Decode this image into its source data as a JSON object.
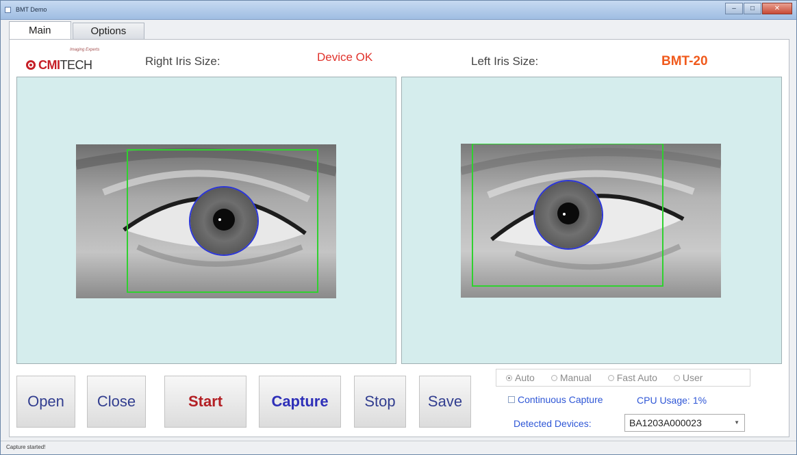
{
  "window": {
    "title": "BMT Demo",
    "controls": [
      "–",
      "□",
      "✕"
    ]
  },
  "tabs": [
    {
      "label": "Main",
      "active": true
    },
    {
      "label": "Options",
      "active": false
    }
  ],
  "logo": {
    "tagline": "Imaging Experts",
    "brand_bold": "CMI",
    "brand_rest": "TECH"
  },
  "header": {
    "right_iris_label": "Right Iris Size:",
    "device_status": "Device OK",
    "left_iris_label": "Left Iris Size:",
    "device_model": "BMT-20"
  },
  "buttons": {
    "open": "Open",
    "close": "Close",
    "start": "Start",
    "capture": "Capture",
    "stop": "Stop",
    "save": "Save"
  },
  "capture_modes": {
    "options": [
      "Auto",
      "Manual",
      "Fast Auto",
      "User"
    ],
    "selected": "Auto"
  },
  "continuous_capture": {
    "label": "Continuous Capture",
    "checked": false
  },
  "cpu_usage": {
    "label": "CPU Usage:",
    "value": "1%"
  },
  "detected_devices": {
    "label": "Detected Devices:",
    "selected": "BA1203A000023"
  },
  "status_bar": {
    "text": "Capture started!"
  },
  "colors": {
    "view_background": "#d5eded",
    "roi_box": "#2fd12f",
    "iris_circle": "#2b35d6",
    "status_ok": "#e0322b",
    "model": "#f05a1c"
  },
  "icons": {
    "app": "app-window-icon",
    "dropdown": "chevron-down-icon"
  }
}
